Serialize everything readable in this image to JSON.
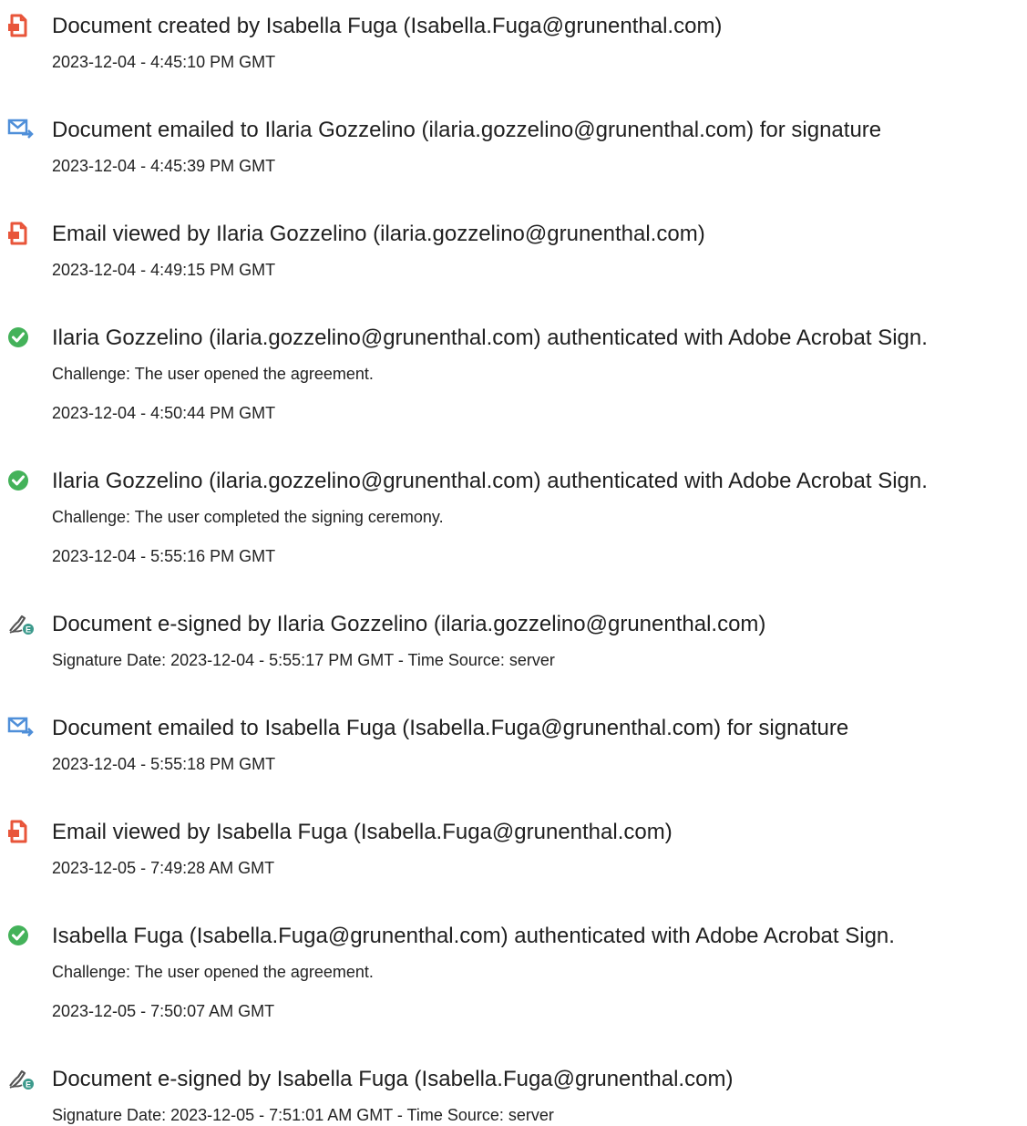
{
  "colors": {
    "doc_icon": "#e8553a",
    "mail_icon": "#4f8fd9",
    "check_icon": "#44b25a",
    "sign_icon": "#3c9a8c",
    "text": "#1f1f1f"
  },
  "events": [
    {
      "icon": "document-icon",
      "title": "Document created by Isabella Fuga (Isabella.Fuga@grunenthal.com)",
      "details": [
        "2023-12-04 - 4:45:10 PM GMT"
      ]
    },
    {
      "icon": "email-icon",
      "title": "Document emailed to Ilaria Gozzelino (ilaria.gozzelino@grunenthal.com) for signature",
      "details": [
        "2023-12-04 - 4:45:39 PM GMT"
      ]
    },
    {
      "icon": "document-icon",
      "title": "Email viewed by Ilaria Gozzelino (ilaria.gozzelino@grunenthal.com)",
      "details": [
        "2023-12-04 - 4:49:15 PM GMT"
      ]
    },
    {
      "icon": "check-icon",
      "title": "Ilaria Gozzelino (ilaria.gozzelino@grunenthal.com) authenticated with Adobe Acrobat Sign.",
      "details": [
        "Challenge: The user opened the agreement.",
        "2023-12-04 - 4:50:44 PM GMT"
      ]
    },
    {
      "icon": "check-icon",
      "title": "Ilaria Gozzelino (ilaria.gozzelino@grunenthal.com) authenticated with Adobe Acrobat Sign.",
      "details": [
        "Challenge: The user completed the signing ceremony.",
        "2023-12-04 - 5:55:16 PM GMT"
      ]
    },
    {
      "icon": "esign-icon",
      "title": "Document e-signed by Ilaria Gozzelino (ilaria.gozzelino@grunenthal.com)",
      "details": [
        "Signature Date: 2023-12-04 - 5:55:17 PM GMT - Time Source: server"
      ]
    },
    {
      "icon": "email-icon",
      "title": "Document emailed to Isabella Fuga (Isabella.Fuga@grunenthal.com) for signature",
      "details": [
        "2023-12-04 - 5:55:18 PM GMT"
      ]
    },
    {
      "icon": "document-icon",
      "title": "Email viewed by Isabella Fuga (Isabella.Fuga@grunenthal.com)",
      "details": [
        "2023-12-05 - 7:49:28 AM GMT"
      ]
    },
    {
      "icon": "check-icon",
      "title": "Isabella Fuga (Isabella.Fuga@grunenthal.com) authenticated with Adobe Acrobat Sign.",
      "details": [
        "Challenge: The user opened the agreement.",
        "2023-12-05 - 7:50:07 AM GMT"
      ]
    },
    {
      "icon": "esign-icon",
      "title": "Document e-signed by Isabella Fuga (Isabella.Fuga@grunenthal.com)",
      "details": [
        "Signature Date: 2023-12-05 - 7:51:01 AM GMT - Time Source: server"
      ]
    }
  ]
}
